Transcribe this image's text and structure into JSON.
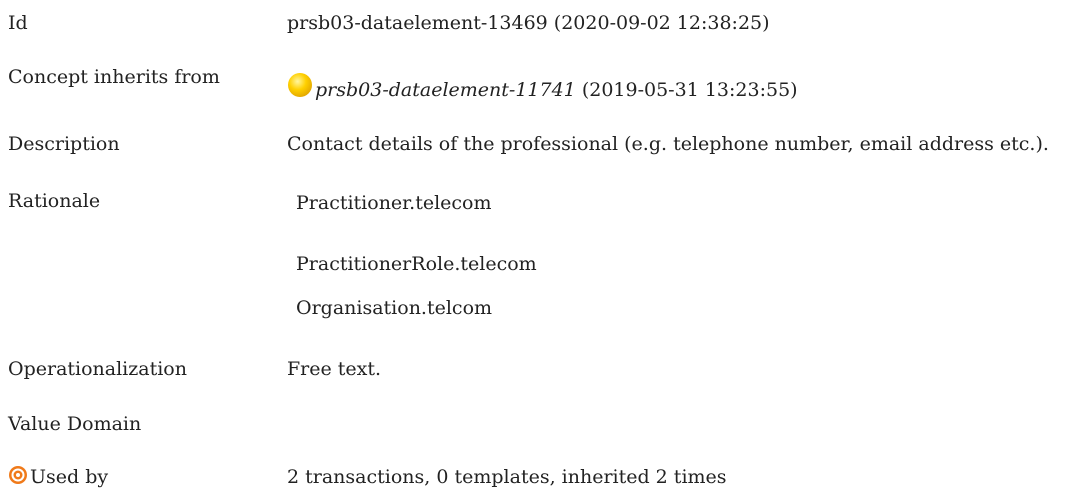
{
  "rows": {
    "id": {
      "label": "Id",
      "value": "prsb03-dataelement-13469 (2020-09-02 12:38:25)"
    },
    "inherits": {
      "label": "Concept inherits from",
      "link_text": "prsb03-dataelement-11741",
      "date_text": " (2019-05-31 13:23:55)",
      "icon": "yellow-orb-icon",
      "icon_color": "#f4c400"
    },
    "description": {
      "label": "Description",
      "value": "Contact details of the professional (e.g. telephone number, email address etc.)."
    },
    "rationale": {
      "label": "Rationale",
      "items": [
        "Practitioner.telecom",
        "PractitionerRole.telecom",
        "Organisation.telcom"
      ]
    },
    "operationalization": {
      "label": "Operationalization",
      "value": "Free text."
    },
    "value_domain": {
      "label": "Value Domain"
    },
    "used_by": {
      "label": "Used by",
      "icon": "target-icon",
      "icon_color": "#f07a1a",
      "value": "2 transactions, 0 templates, inherited 2 times"
    }
  }
}
